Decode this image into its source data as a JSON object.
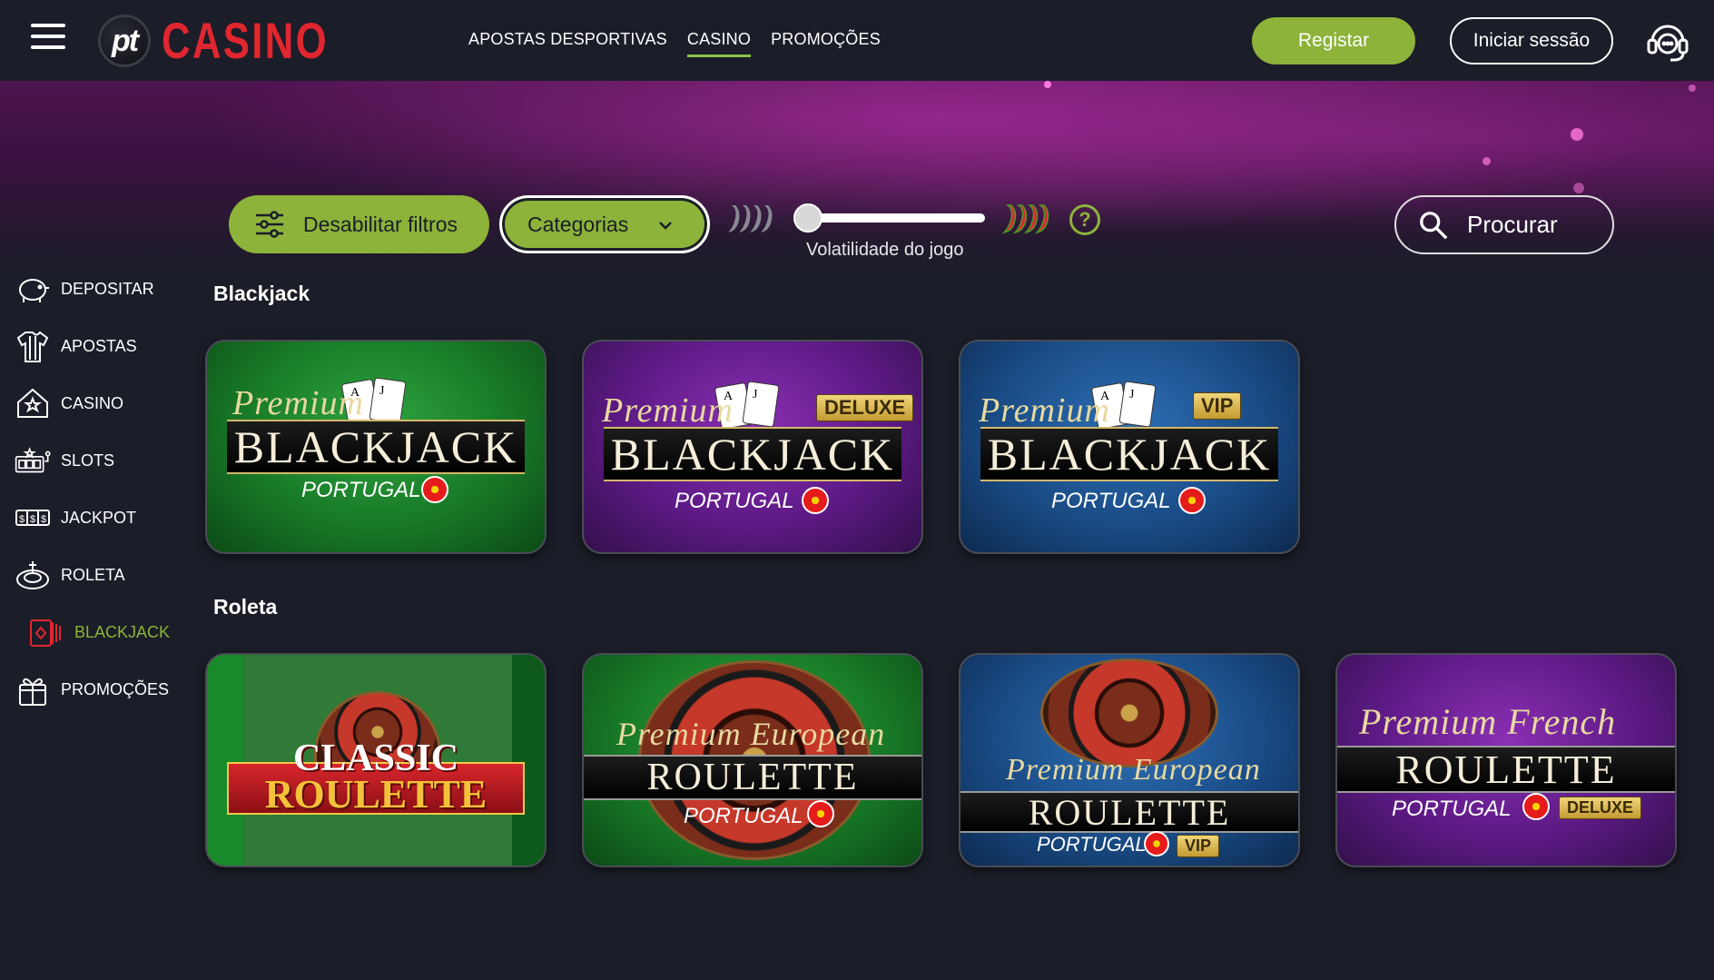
{
  "header": {
    "logo_badge": "pt",
    "logo_text": "CASINO",
    "nav": [
      {
        "label": "APOSTAS DESPORTIVAS",
        "active": false
      },
      {
        "label": "CASINO",
        "active": true
      },
      {
        "label": "PROMOÇÕES",
        "active": false
      }
    ],
    "register_label": "Registar",
    "login_label": "Iniciar sessão"
  },
  "filters": {
    "disable_label": "Desabilitar filtros",
    "categories_label": "Categorias",
    "volatility_label": "Volatilidade do jogo",
    "volatility_value": 0,
    "help_label": "?",
    "search_placeholder": "Procurar"
  },
  "sidebar": {
    "items": [
      {
        "label": "DEPOSITAR",
        "icon": "piggy-bank-icon",
        "active": false
      },
      {
        "label": "APOSTAS",
        "icon": "jersey-icon",
        "active": false
      },
      {
        "label": "CASINO",
        "icon": "house-star-icon",
        "active": false
      },
      {
        "label": "SLOTS",
        "icon": "slot-machine-icon",
        "active": false
      },
      {
        "label": "JACKPOT",
        "icon": "jackpot-icon",
        "active": false
      },
      {
        "label": "ROLETA",
        "icon": "roulette-icon",
        "active": false
      },
      {
        "label": "BLACKJACK",
        "icon": "cards-icon",
        "active": true
      },
      {
        "label": "PROMOÇÕES",
        "icon": "gift-icon",
        "active": false
      }
    ]
  },
  "sections": {
    "blackjack": {
      "title": "Blackjack",
      "games": [
        {
          "premium": "Premium",
          "name": "BLACKJACK",
          "sub": "PORTUGAL",
          "badge": ""
        },
        {
          "premium": "Premium",
          "name": "BLACKJACK",
          "sub": "PORTUGAL",
          "badge": "DELUXE"
        },
        {
          "premium": "Premium",
          "name": "BLACKJACK",
          "sub": "PORTUGAL",
          "badge": "VIP"
        }
      ]
    },
    "roleta": {
      "title": "Roleta",
      "games": [
        {
          "line1": "CLASSIC",
          "line2": "ROULETTE"
        },
        {
          "premium": "Premium European",
          "name": "ROULETTE",
          "sub": "PORTUGAL",
          "badge": ""
        },
        {
          "premium": "Premium European",
          "name": "ROULETTE",
          "sub": "PORTUGAL",
          "badge": "VIP"
        },
        {
          "premium": "Premium French",
          "name": "ROULETTE",
          "sub": "PORTUGAL",
          "badge": "DELUXE"
        }
      ]
    }
  },
  "colors": {
    "accent": "#8db33a",
    "logo_red": "#e0262f",
    "background": "#1b1d28"
  }
}
